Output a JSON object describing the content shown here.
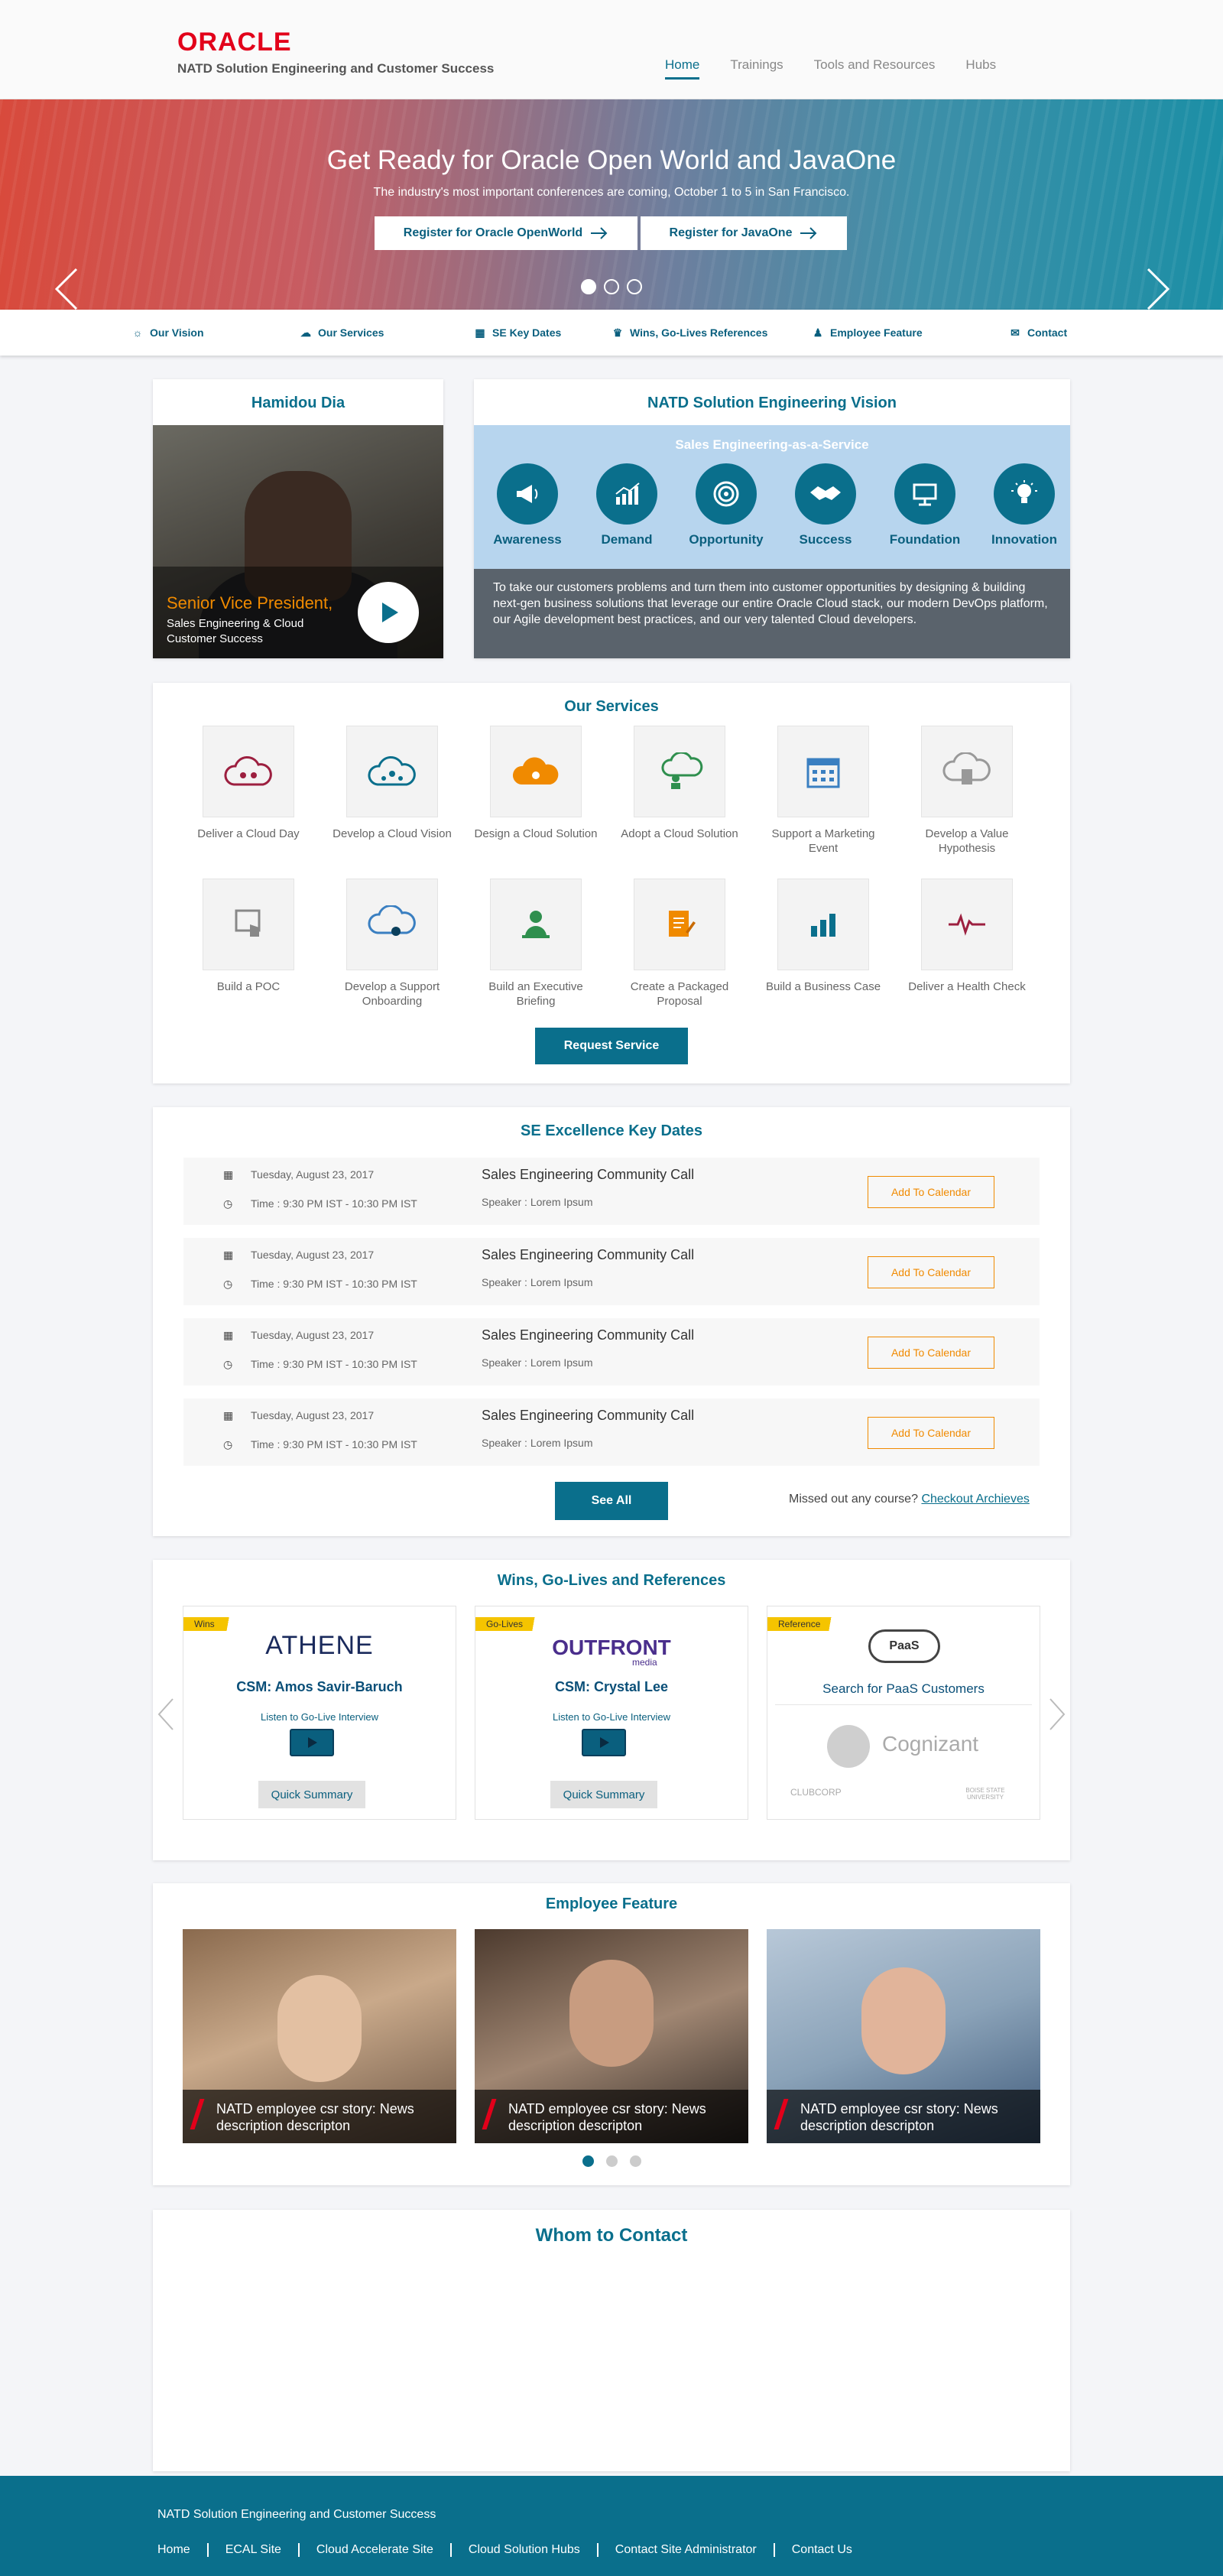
{
  "header": {
    "logo": "ORACLE",
    "subtitle": "NATD Solution Engineering and Customer Success",
    "nav": [
      "Home",
      "Trainings",
      "Tools and Resources",
      "Hubs"
    ]
  },
  "hero": {
    "title": "Get Ready for Oracle Open World and JavaOne",
    "subtitle": "The industry's most important conferences are coming, October 1 to 5 in San Francisco.",
    "button1": "Register for Oracle OpenWorld",
    "button2": "Register for JavaOne"
  },
  "subnav": [
    "Our Vision",
    "Our Services",
    "SE Key Dates",
    "Wins, Go-Lives References",
    "Employee Feature",
    "Contact"
  ],
  "leader": {
    "name": "Hamidou Dia",
    "role": "Senior Vice President,",
    "dept": "Sales Engineering & Cloud Customer Success"
  },
  "vision": {
    "title": "NATD Solution Engineering Vision",
    "subtitle": "Sales Engineering-as-a-Service",
    "items": [
      "Awareness",
      "Demand",
      "Opportunity",
      "Success",
      "Foundation",
      "Innovation"
    ],
    "description": "To take our customers problems and turn them into customer opportunities by designing & building next-gen business solutions that leverage our entire Oracle Cloud stack, our modern DevOps platform, our Agile development best practices, and our very talented Cloud developers."
  },
  "services": {
    "title": "Our Services",
    "items": [
      "Deliver a Cloud Day",
      "Develop a Cloud Vision",
      "Design a Cloud Solution",
      "Adopt a Cloud Solution",
      "Support a Marketing Event",
      "Develop a Value Hypothesis",
      "Build a POC",
      "Develop a Support Onboarding",
      "Build an Executive Briefing",
      "Create a Packaged Proposal",
      "Build a Business Case",
      "Deliver a Health Check"
    ],
    "button": "Request Service"
  },
  "keydates": {
    "title": "SE Excellence Key Dates",
    "events": [
      {
        "date": "Tuesday, August 23, 2017",
        "time": "Time : 9:30 PM IST - 10:30 PM IST",
        "title": "Sales Engineering Community Call",
        "speaker": "Speaker : Lorem Ipsum",
        "action": "Add To Calendar"
      },
      {
        "date": "Tuesday, August 23, 2017",
        "time": "Time : 9:30 PM IST - 10:30 PM IST",
        "title": "Sales Engineering Community Call",
        "speaker": "Speaker : Lorem Ipsum",
        "action": "Add To Calendar"
      },
      {
        "date": "Tuesday, August 23, 2017",
        "time": "Time : 9:30 PM IST - 10:30 PM IST",
        "title": "Sales Engineering Community Call",
        "speaker": "Speaker : Lorem Ipsum",
        "action": "Add To Calendar"
      },
      {
        "date": "Tuesday, August 23, 2017",
        "time": "Time : 9:30 PM IST - 10:30 PM IST",
        "title": "Sales Engineering Community Call",
        "speaker": "Speaker : Lorem Ipsum",
        "action": "Add To Calendar"
      }
    ],
    "see_all": "See All",
    "missed": "Missed out any course?",
    "archives": "Checkout Archieves"
  },
  "wins": {
    "title": "Wins, Go-Lives and References",
    "cards": [
      {
        "tag": "Wins",
        "logo": "ATHENE",
        "csm": "CSM: Amos Savir-Baruch",
        "listen": "Listen to Go-Live Interview",
        "summary": "Quick Summary"
      },
      {
        "tag": "Go-Lives",
        "logo": "OUTFRONT",
        "logo_sub": "media",
        "csm": "CSM: Crystal Lee",
        "listen": "Listen to Go-Live Interview",
        "summary": "Quick Summary"
      },
      {
        "tag": "Reference",
        "badge": "PaaS",
        "search": "Search for PaaS Customers",
        "brand1": "Cognizant",
        "brand2": "CLUBCORP",
        "brand3": "BOISE STATE UNIVERSITY"
      }
    ]
  },
  "employee": {
    "title": "Employee Feature",
    "items": [
      "NATD employee csr story: News description descripton",
      "NATD employee csr story: News description descripton",
      "NATD employee csr story: News description descripton"
    ]
  },
  "contact": {
    "title": "Whom to Contact"
  },
  "footer": {
    "title": "NATD Solution Engineering and Customer Success",
    "links": [
      "Home",
      "ECAL Site",
      "Cloud Accelerate Site",
      "Cloud Solution Hubs",
      "Contact Site Administrator",
      "Contact Us"
    ]
  },
  "colors": {
    "brand": "#0a6f8c",
    "oracle_red": "#e2001a",
    "accent_orange": "#f08a00"
  }
}
